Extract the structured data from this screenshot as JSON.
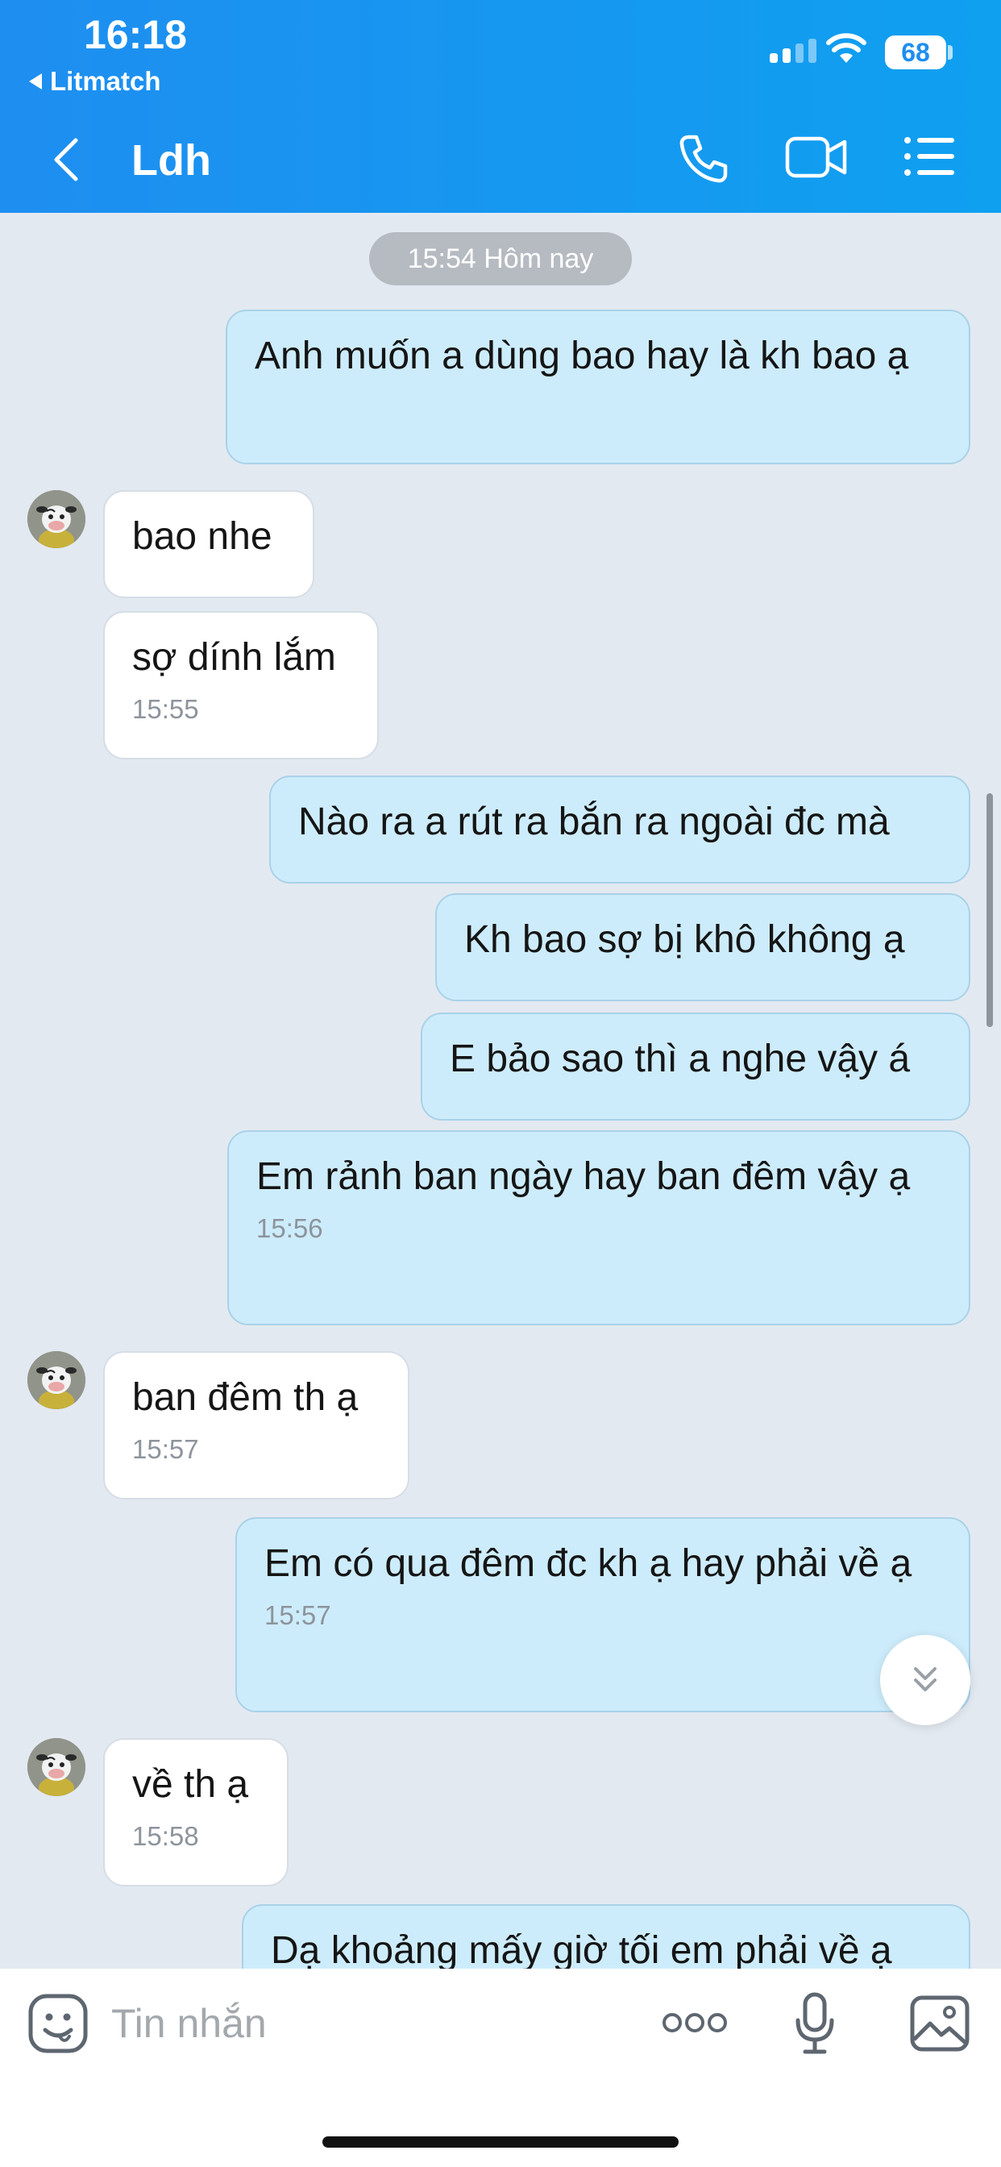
{
  "status_bar": {
    "time": "16:18",
    "back_app": "Litmatch",
    "battery": "68"
  },
  "header": {
    "title": "Ldh",
    "icons": [
      "back-chevron-icon",
      "phone-icon",
      "video-camera-icon",
      "list-menu-icon"
    ]
  },
  "chat": {
    "date_divider": "15:54 Hôm nay",
    "messages": [
      {
        "side": "out",
        "text": "Anh muốn a dùng bao hay là kh bao ạ",
        "time": ""
      },
      {
        "side": "in",
        "text": "bao nhe",
        "time": ""
      },
      {
        "side": "in",
        "text": "sợ dính lắm",
        "time": "15:55"
      },
      {
        "side": "out",
        "text": "Nào ra a rút ra bắn ra ngoài đc mà",
        "time": ""
      },
      {
        "side": "out",
        "text": "Kh bao sợ bị khô không ạ",
        "time": ""
      },
      {
        "side": "out",
        "text": "E bảo sao thì a nghe vậy á",
        "time": ""
      },
      {
        "side": "out",
        "text": "Em rảnh ban ngày hay ban đêm vậy ạ",
        "time": "15:56"
      },
      {
        "side": "in",
        "text": "ban đêm th ạ",
        "time": "15:57"
      },
      {
        "side": "out",
        "text": "Em có qua đêm đc kh ạ hay phải về ạ",
        "time": "15:57"
      },
      {
        "side": "in",
        "text": "về th ạ",
        "time": "15:58"
      },
      {
        "side": "out",
        "text": "Dạ khoảng mấy giờ tối em phải về ạ",
        "time": ""
      }
    ]
  },
  "input": {
    "placeholder": "Tin nhắn"
  },
  "colors": {
    "header_start": "#1e8ef0",
    "header_end": "#0fa0f0",
    "outgoing_bubble": "#cdecfb",
    "incoming_bubble": "#ffffff",
    "chat_background": "#e3e9f1"
  }
}
